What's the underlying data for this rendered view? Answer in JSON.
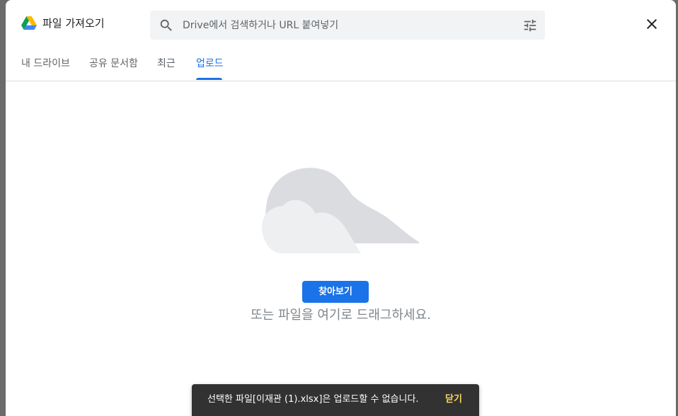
{
  "header": {
    "title": "파일 가져오기",
    "search_placeholder": "Drive에서 검색하거나 URL 붙여넣기"
  },
  "tabs": [
    {
      "label": "내 드라이브"
    },
    {
      "label": "공유 문서함"
    },
    {
      "label": "최근"
    },
    {
      "label": "업로드"
    }
  ],
  "upload": {
    "browse_label": "찾아보기",
    "drop_hint": "또는 파일을 여기로 드래그하세요."
  },
  "snackbar": {
    "message": "선택한 파일[이재관 (1).xlsx]은 업로드할 수 없습니다.",
    "action": "닫기"
  },
  "colors": {
    "accent": "#1a73e8",
    "snackbar_bg": "#323232",
    "snackbar_action": "#fdd663"
  },
  "icons": [
    "google-drive-logo",
    "search-icon",
    "tune-icon",
    "close-icon",
    "cloud-illustration"
  ]
}
